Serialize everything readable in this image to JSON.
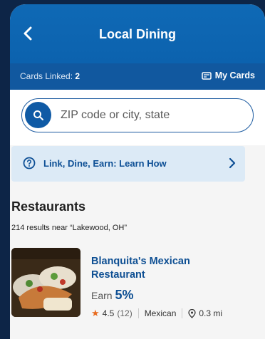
{
  "header": {
    "title": "Local Dining",
    "back_icon": "chevron-left-icon"
  },
  "subbar": {
    "cards_linked_label": "Cards Linked:",
    "cards_linked_count": "2",
    "my_cards_label": "My Cards",
    "my_cards_icon": "card-icon"
  },
  "search": {
    "placeholder": "ZIP code or city, state",
    "value": "",
    "icon": "search-icon"
  },
  "banner": {
    "text": "Link, Dine, Earn: Learn How",
    "icon": "question-circle-icon",
    "chevron": "chevron-right-icon"
  },
  "section": {
    "title": "Restaurants",
    "results_count": "214 results",
    "results_suffix": "near “Lakewood, OH”"
  },
  "restaurants": [
    {
      "name": "Blanquita's Mexican Restaurant",
      "earn_label": "Earn",
      "earn_value": "5%",
      "rating": "4.5",
      "reviews": "(12)",
      "cuisine": "Mexican",
      "distance": "0.3 mi"
    }
  ],
  "colors": {
    "primary": "#0f69b5",
    "accent_text": "#0e4f93",
    "star": "#e86b1f",
    "banner_bg": "#dceaf6"
  }
}
